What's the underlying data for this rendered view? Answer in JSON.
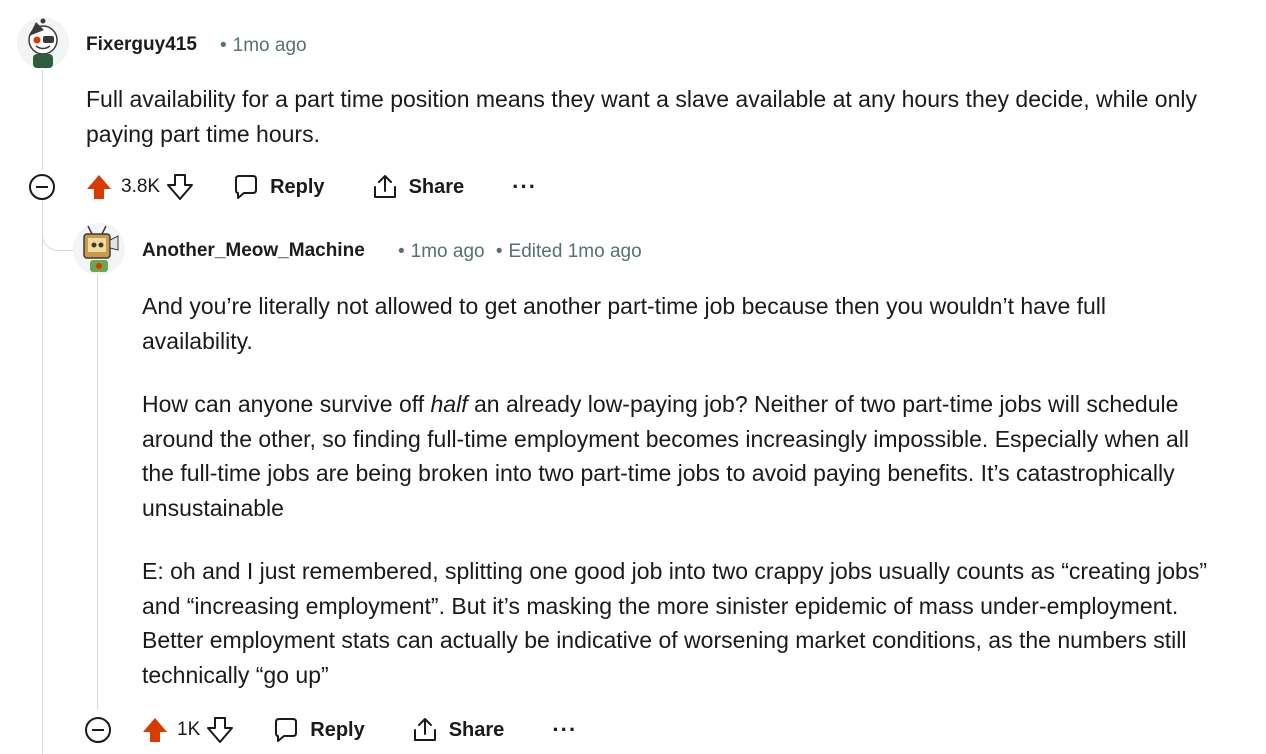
{
  "comments": [
    {
      "username": "Fixerguy415",
      "time": "1mo ago",
      "edited": "",
      "paragraphs": [
        {
          "before": "Full availability for a part time position means they want a slave available at any hours they decide, while only paying part time hours.",
          "em": "",
          "after": ""
        }
      ],
      "score": "3.8K",
      "reply_label": "Reply",
      "share_label": "Share",
      "more_label": "···",
      "upvoted": true,
      "accent": "#d93a00"
    },
    {
      "username": "Another_Meow_Machine",
      "time": "1mo ago",
      "edited": "Edited 1mo ago",
      "paragraphs": [
        {
          "before": "And you’re literally not allowed to get another part-time job because then you wouldn’t have full availability.",
          "em": "",
          "after": ""
        },
        {
          "before": "How can anyone survive off ",
          "em": "half",
          "after": " an already low-paying job? Neither of two part-time jobs will schedule around the other, so finding full-time employment becomes increasingly impossible. Especially when all the full-time jobs are being broken into two part-time jobs to avoid paying benefits. It’s catastrophically unsustainable"
        },
        {
          "before": "E: oh and I just remembered, splitting one good job into two crappy jobs usually counts as “creating jobs” and “increasing employment”. But it’s masking the more sinister epidemic of mass under-employment. Better employment stats can actually be indicative of worsening market conditions, as the numbers still technically “go up”",
          "em": "",
          "after": ""
        }
      ],
      "score": "1K",
      "reply_label": "Reply",
      "share_label": "Share",
      "more_label": "···",
      "upvoted": true,
      "accent": "#d93a00"
    }
  ],
  "icons": {
    "collapse": "collapse-icon",
    "upvote": "upvote-icon",
    "downvote": "downvote-icon",
    "reply": "reply-bubble-icon",
    "share": "share-icon",
    "more": "more-dots-icon"
  }
}
